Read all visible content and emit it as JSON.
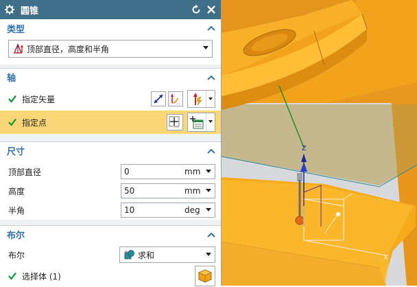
{
  "dialog": {
    "title": "圆锥",
    "icons": {
      "settings": "gear-icon",
      "reset": "reset-icon",
      "close": "close-icon"
    }
  },
  "sections": {
    "type": {
      "title": "类型",
      "value": "顶部直径，高度和半角"
    },
    "axis": {
      "title": "轴",
      "vector_label": "指定矢量",
      "point_label": "指定点"
    },
    "dimensions": {
      "title": "尺寸",
      "rows": [
        {
          "label": "顶部直径",
          "value": "0",
          "unit": "mm"
        },
        {
          "label": "高度",
          "value": "50",
          "unit": "mm"
        },
        {
          "label": "半角",
          "value": "10",
          "unit": "deg"
        }
      ]
    },
    "boolean": {
      "title": "布尔",
      "label": "布尔",
      "value": "求和",
      "select_body": "选择体 (1)"
    }
  },
  "viewport": {
    "axis_z_label": "Z",
    "axis_x_label": "X",
    "colors": {
      "body": "#f0a11a",
      "body_dark": "#d5870f",
      "body_light": "#ffc64a",
      "background": "#d7d9dc"
    }
  }
}
